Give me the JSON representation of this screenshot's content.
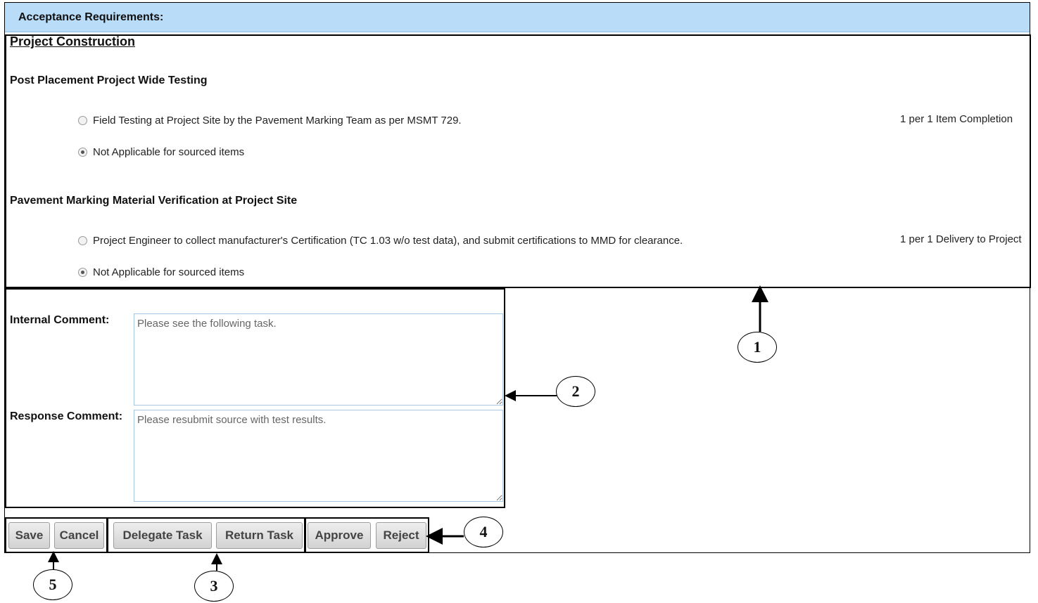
{
  "header": {
    "title": "Acceptance Requirements:"
  },
  "section": {
    "title": "Project Construction"
  },
  "groups": [
    {
      "title": "Post Placement Project Wide Testing",
      "options": [
        {
          "label": "Field Testing at Project Site by the Pavement Marking Team as per MSMT 729.",
          "checked": false,
          "frequency": "1 per 1 Item Completion"
        },
        {
          "label": "Not Applicable for sourced items",
          "checked": true,
          "frequency": ""
        }
      ]
    },
    {
      "title": "Pavement Marking Material Verification at Project Site",
      "options": [
        {
          "label": "Project Engineer to collect manufacturer's Certification (TC 1.03 w/o test data), and submit certifications to MMD for clearance.",
          "checked": false,
          "frequency": "1 per 1 Delivery to Project"
        },
        {
          "label": "Not Applicable for sourced items",
          "checked": true,
          "frequency": ""
        }
      ]
    }
  ],
  "comments": {
    "internal_label": "Internal Comment:",
    "internal_value": "Please see the following task.",
    "response_label": "Response Comment:",
    "response_value": "Please resubmit source with test results."
  },
  "buttons": {
    "save": "Save",
    "cancel": "Cancel",
    "delegate": "Delegate Task",
    "return": "Return Task",
    "approve": "Approve",
    "reject": "Reject"
  },
  "callouts": {
    "c1": "1",
    "c2": "2",
    "c3": "3",
    "c4": "4",
    "c5": "5"
  }
}
